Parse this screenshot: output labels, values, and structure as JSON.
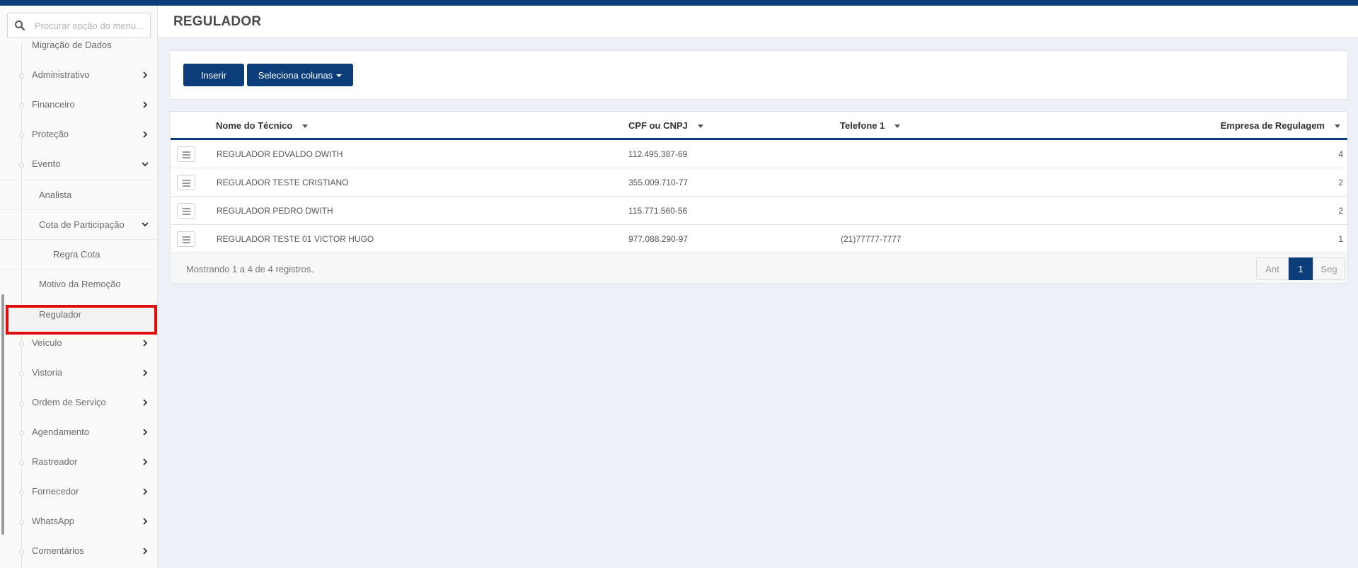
{
  "search": {
    "placeholder": "Procurar opção do menu..."
  },
  "sidebar": {
    "items": [
      {
        "label": "Migração de Dados"
      },
      {
        "label": "Administrativo"
      },
      {
        "label": "Financeiro"
      },
      {
        "label": "Proteção"
      },
      {
        "label": "Evento"
      },
      {
        "label": "Analista"
      },
      {
        "label": "Cota de Participação"
      },
      {
        "label": "Regra Cota"
      },
      {
        "label": "Motivo da Remoção"
      },
      {
        "label": "Regulador"
      },
      {
        "label": "Veículo"
      },
      {
        "label": "Vistoria"
      },
      {
        "label": "Ordem de Serviço"
      },
      {
        "label": "Agendamento"
      },
      {
        "label": "Rastreador"
      },
      {
        "label": "Fornecedor"
      },
      {
        "label": "WhatsApp"
      },
      {
        "label": "Comentários"
      }
    ]
  },
  "header": {
    "title": "REGULADOR"
  },
  "toolbar": {
    "insert_label": "Inserir",
    "columns_label": "Seleciona colunas"
  },
  "table": {
    "columns": [
      "Nome do Técnico",
      "CPF ou CNPJ",
      "Telefone 1",
      "Empresa de Regulagem"
    ],
    "rows": [
      {
        "nome": "REGULADOR EDVALDO DWITH",
        "cpf": "112.495.387-69",
        "telefone": "",
        "empresa": "4"
      },
      {
        "nome": "REGULADOR TESTE CRISTIANO",
        "cpf": "355.009.710-77",
        "telefone": "",
        "empresa": "2"
      },
      {
        "nome": "REGULADOR PEDRO DWITH",
        "cpf": "115.771.560-56",
        "telefone": "",
        "empresa": "2"
      },
      {
        "nome": "REGULADOR TESTE 01 VICTOR HUGO",
        "cpf": "977.088.290-97",
        "telefone": "(21)77777-7777",
        "empresa": "1"
      }
    ]
  },
  "footer": {
    "summary": "Mostrando 1 a 4 de 4 registros.",
    "prev": "Ant",
    "current_page": "1",
    "next": "Seg"
  },
  "colors": {
    "brand": "#0b3d7a",
    "highlight": "#e00d0d"
  }
}
